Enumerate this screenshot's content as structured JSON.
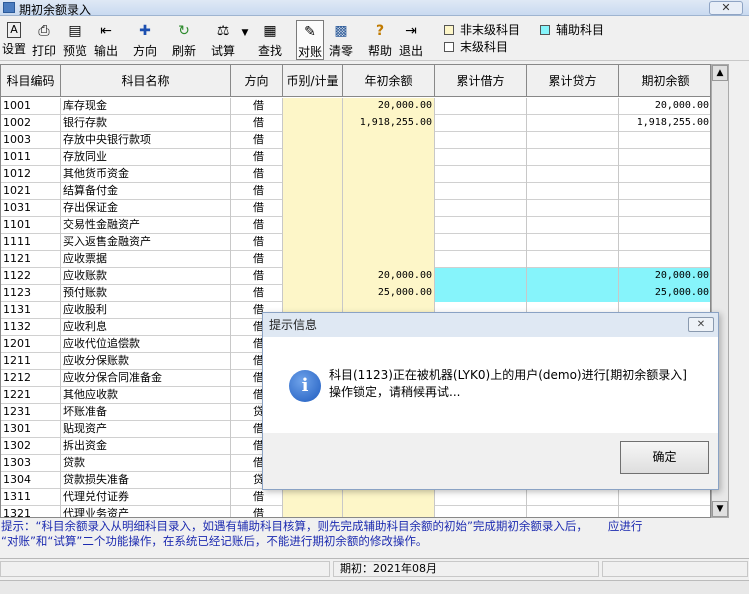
{
  "window": {
    "title": "期初余额录入",
    "close": "✕"
  },
  "toolbar": {
    "buttons": [
      {
        "icon": "A",
        "label": "设置"
      },
      {
        "icon": "⎙",
        "label": "打印"
      },
      {
        "icon": "▤",
        "label": "预览"
      },
      {
        "icon": "⇤",
        "label": "输出"
      },
      {
        "icon": "✚",
        "label": "方向"
      },
      {
        "icon": "↻",
        "label": "刷新"
      },
      {
        "icon": "⚖",
        "label": "试算",
        "dropdown": "▼"
      },
      {
        "icon": "▦",
        "label": "查找"
      },
      {
        "icon": "✎",
        "label": "对账"
      },
      {
        "icon": "▩",
        "label": "清零"
      },
      {
        "icon": "?",
        "label": "帮助"
      },
      {
        "icon": "⇥",
        "label": "退出"
      }
    ]
  },
  "legend": {
    "nonleaf": "非末级科目",
    "aux": "辅助科目",
    "leaf": "末级科目",
    "colors": {
      "nonleaf": "#fdf6c8",
      "aux": "#86f4fb",
      "leaf": "#ffffff"
    }
  },
  "table": {
    "columns": [
      "科目编码",
      "科目名称",
      "方向",
      "币别/计量",
      "年初余额",
      "累计借方",
      "累计贷方",
      "期初余额"
    ],
    "rows": [
      {
        "code": "1001",
        "name": "库存现金",
        "dir": "借",
        "cur": "",
        "year": "20,000.00",
        "dr": "",
        "cr": "",
        "bal": "20,000.00"
      },
      {
        "code": "1002",
        "name": "银行存款",
        "dir": "借",
        "cur": "",
        "year": "1,918,255.00",
        "dr": "",
        "cr": "",
        "bal": "1,918,255.00"
      },
      {
        "code": "1003",
        "name": "存放中央银行款项",
        "dir": "借",
        "cur": "",
        "year": "",
        "dr": "",
        "cr": "",
        "bal": ""
      },
      {
        "code": "1011",
        "name": "存放同业",
        "dir": "借",
        "cur": "",
        "year": "",
        "dr": "",
        "cr": "",
        "bal": ""
      },
      {
        "code": "1012",
        "name": "其他货币资金",
        "dir": "借",
        "cur": "",
        "year": "",
        "dr": "",
        "cr": "",
        "bal": ""
      },
      {
        "code": "1021",
        "name": "结算备付金",
        "dir": "借",
        "cur": "",
        "year": "",
        "dr": "",
        "cr": "",
        "bal": ""
      },
      {
        "code": "1031",
        "name": "存出保证金",
        "dir": "借",
        "cur": "",
        "year": "",
        "dr": "",
        "cr": "",
        "bal": ""
      },
      {
        "code": "1101",
        "name": "交易性金融资产",
        "dir": "借",
        "cur": "",
        "year": "",
        "dr": "",
        "cr": "",
        "bal": ""
      },
      {
        "code": "1111",
        "name": "买入返售金融资产",
        "dir": "借",
        "cur": "",
        "year": "",
        "dr": "",
        "cr": "",
        "bal": ""
      },
      {
        "code": "1121",
        "name": "应收票据",
        "dir": "借",
        "cur": "",
        "year": "",
        "dr": "",
        "cr": "",
        "bal": ""
      },
      {
        "code": "1122",
        "name": "应收账款",
        "dir": "借",
        "cur": "",
        "year": "20,000.00",
        "dr": "",
        "cr": "",
        "bal": "20,000.00",
        "aux": true
      },
      {
        "code": "1123",
        "name": "预付账款",
        "dir": "借",
        "cur": "",
        "year": "25,000.00",
        "dr": "",
        "cr": "",
        "bal": "25,000.00",
        "aux": true
      },
      {
        "code": "1131",
        "name": "应收股利",
        "dir": "借",
        "cur": "",
        "year": "",
        "dr": "",
        "cr": "",
        "bal": ""
      },
      {
        "code": "1132",
        "name": "应收利息",
        "dir": "借",
        "cur": "",
        "year": "",
        "dr": "",
        "cr": "",
        "bal": ""
      },
      {
        "code": "1201",
        "name": "应收代位追偿款",
        "dir": "借",
        "cur": "",
        "year": "",
        "dr": "",
        "cr": "",
        "bal": ""
      },
      {
        "code": "1211",
        "name": "应收分保账款",
        "dir": "借",
        "cur": "",
        "year": "",
        "dr": "",
        "cr": "",
        "bal": ""
      },
      {
        "code": "1212",
        "name": "应收分保合同准备金",
        "dir": "借",
        "cur": "",
        "year": "",
        "dr": "",
        "cr": "",
        "bal": ""
      },
      {
        "code": "1221",
        "name": "其他应收款",
        "dir": "借",
        "cur": "",
        "year": "",
        "dr": "",
        "cr": "",
        "bal": ""
      },
      {
        "code": "1231",
        "name": "坏账准备",
        "dir": "贷",
        "cur": "",
        "year": "",
        "dr": "",
        "cr": "",
        "bal": ""
      },
      {
        "code": "1301",
        "name": "贴现资产",
        "dir": "借",
        "cur": "",
        "year": "",
        "dr": "",
        "cr": "",
        "bal": ""
      },
      {
        "code": "1302",
        "name": "拆出资金",
        "dir": "借",
        "cur": "",
        "year": "",
        "dr": "",
        "cr": "",
        "bal": ""
      },
      {
        "code": "1303",
        "name": "贷款",
        "dir": "借",
        "cur": "",
        "year": "",
        "dr": "",
        "cr": "",
        "bal": ""
      },
      {
        "code": "1304",
        "name": "贷款损失准备",
        "dir": "贷",
        "cur": "",
        "year": "",
        "dr": "",
        "cr": "",
        "bal": ""
      },
      {
        "code": "1311",
        "name": "代理兑付证券",
        "dir": "借",
        "cur": "",
        "year": "",
        "dr": "",
        "cr": "",
        "bal": ""
      },
      {
        "code": "1321",
        "name": "代理业务资产",
        "dir": "借",
        "cur": "",
        "year": "",
        "dr": "",
        "cr": "",
        "bal": ""
      }
    ]
  },
  "hint": {
    "line1": "提示：“科目余额录入从明细科目录入，如遇有辅助科目核算，则先完成辅助科目余额的初始”完成期初余额录入后，",
    "line1b": "应进行",
    "line2": "“对账”和“试算”二个功能操作，在系统已经记账后，不能进行期初余额的修改操作。"
  },
  "status": {
    "period": "期初：2021年08月"
  },
  "dialog": {
    "title": "提示信息",
    "close": "✕",
    "icon": "i",
    "message_line1": "科目(1123)正在被机器(LYK0)上的用户(demo)进行[期初余额录入]",
    "message_line2": "操作锁定，请稍候再试...",
    "ok": "确定"
  }
}
